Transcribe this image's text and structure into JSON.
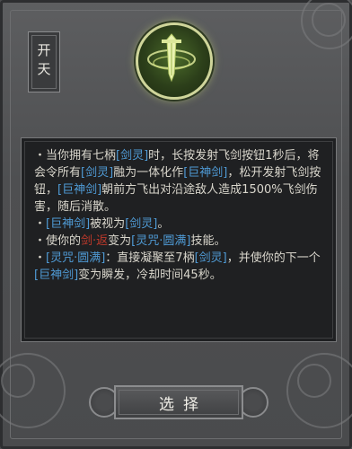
{
  "card": {
    "title": "开天",
    "icon": "sword-emblem-icon",
    "accent_color": "#4f9bd6",
    "warning_color": "#c0392b"
  },
  "description": {
    "p1": {
      "a": "・当你拥有七柄",
      "b": "[剑灵]",
      "c": "时，长按发射飞剑按钮1秒后，将会令所有",
      "d": "[剑灵]",
      "e": "融为一体化作",
      "f": "[巨神剑]",
      "g": "，松开发射飞剑按钮，",
      "h": "[巨神剑]",
      "i": "朝前方飞出对沿途敌人造成1500%飞剑伤害，随后消散。"
    },
    "p2": {
      "a": "・",
      "b": "[巨神剑]",
      "c": "被视为",
      "d": "[剑灵]",
      "e": "。"
    },
    "p3": {
      "a": "・使你的",
      "b": "剑·返",
      "c": "变为",
      "d": "[灵咒·圆满]",
      "e": "技能。"
    },
    "p4": {
      "a": "・",
      "b": "[灵咒·圆满]",
      "c": "：直接凝聚至7柄",
      "d": "[剑灵]",
      "e": "，并使你的下一个",
      "f": "[巨神剑]",
      "g": "变为瞬发，冷却时间45秒。"
    }
  },
  "actions": {
    "select_label": "选择"
  }
}
